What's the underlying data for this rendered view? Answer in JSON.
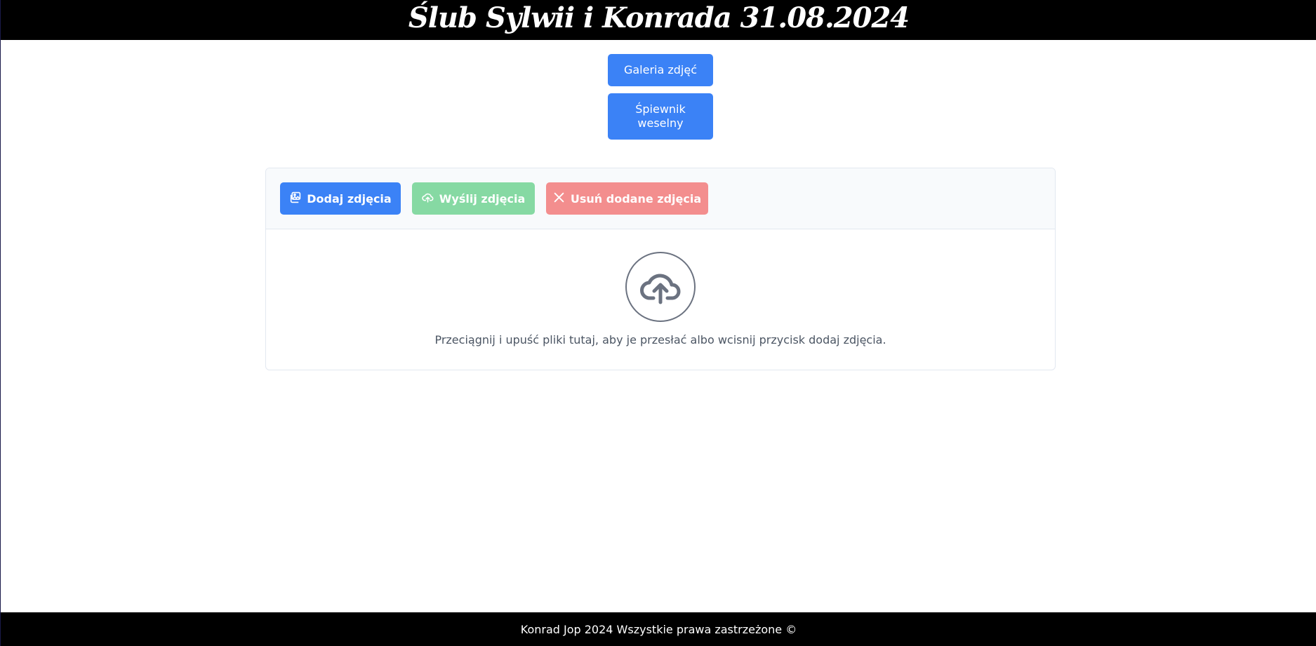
{
  "header": {
    "title": "Ślub Sylwii i Konrada 31.08.2024"
  },
  "nav": {
    "gallery_label": "Galeria zdjęć",
    "songbook_label": "Śpiewnik weselny"
  },
  "uploader": {
    "add_label": "Dodaj zdjęcia",
    "send_label": "Wyślij zdjęcia",
    "remove_label": "Usuń dodane zdjęcia",
    "drop_hint": "Przeciągnij i upuść pliki tutaj, aby je przesłać albo wcisnij przycisk dodaj zdjęcia.",
    "icons": {
      "add": "images-icon",
      "send": "cloud-upload-icon",
      "remove": "close-icon",
      "dropzone": "cloud-upload-icon"
    }
  },
  "footer": {
    "text": "Konrad Jop 2024 Wszystkie prawa zastrzeżone ©"
  },
  "colors": {
    "primary": "#3b82f6",
    "success": "#86d9a3",
    "danger": "#f38e8e",
    "header_bg": "#000000"
  }
}
